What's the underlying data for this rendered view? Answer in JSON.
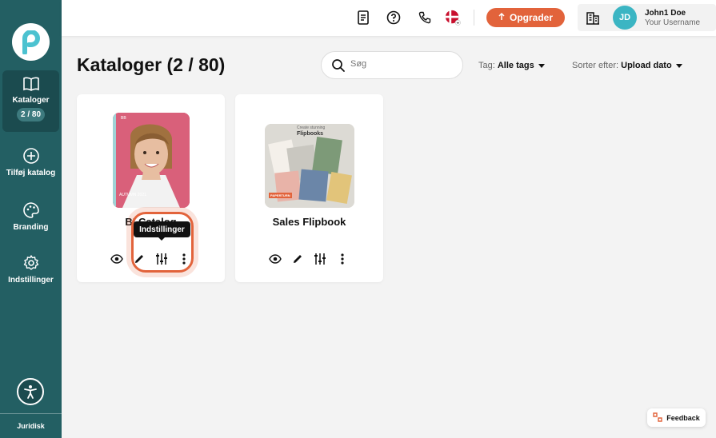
{
  "sidebar": {
    "items": [
      {
        "label": "Kataloger",
        "badge": "2 / 80",
        "icon": "book-open-icon",
        "active": true
      },
      {
        "label": "Tilføj katalog",
        "icon": "plus-circle-icon"
      },
      {
        "label": "Branding",
        "icon": "palette-icon"
      },
      {
        "label": "Indstillinger",
        "icon": "gear-icon"
      }
    ],
    "legal": "Juridisk"
  },
  "header": {
    "upgrade_label": "Opgrader",
    "user": {
      "initials": "JD",
      "name": "John1 Doe",
      "username": "Your Username"
    }
  },
  "main": {
    "title": "Kataloger (2 / 80)",
    "search_placeholder": "Søg",
    "tag_filter": {
      "label": "Tag:",
      "value": "Alle tags"
    },
    "sort": {
      "label": "Sorter efter:",
      "value": "Upload dato"
    },
    "catalogs": [
      {
        "title": "BI Catalog",
        "cover_text_top": "BB",
        "cover_text_bottom": "AUTUMN 2021"
      },
      {
        "title": "Sales Flipbook",
        "cover_text_top": "Create stunning",
        "cover_text_mid": "Flipbooks",
        "brand": "PAPERTURN"
      }
    ],
    "tooltip": "Indstillinger"
  },
  "feedback_label": "Feedback",
  "colors": {
    "sidebar": "#235f63",
    "accent": "#e2633b",
    "avatar": "#3bb5c3"
  }
}
